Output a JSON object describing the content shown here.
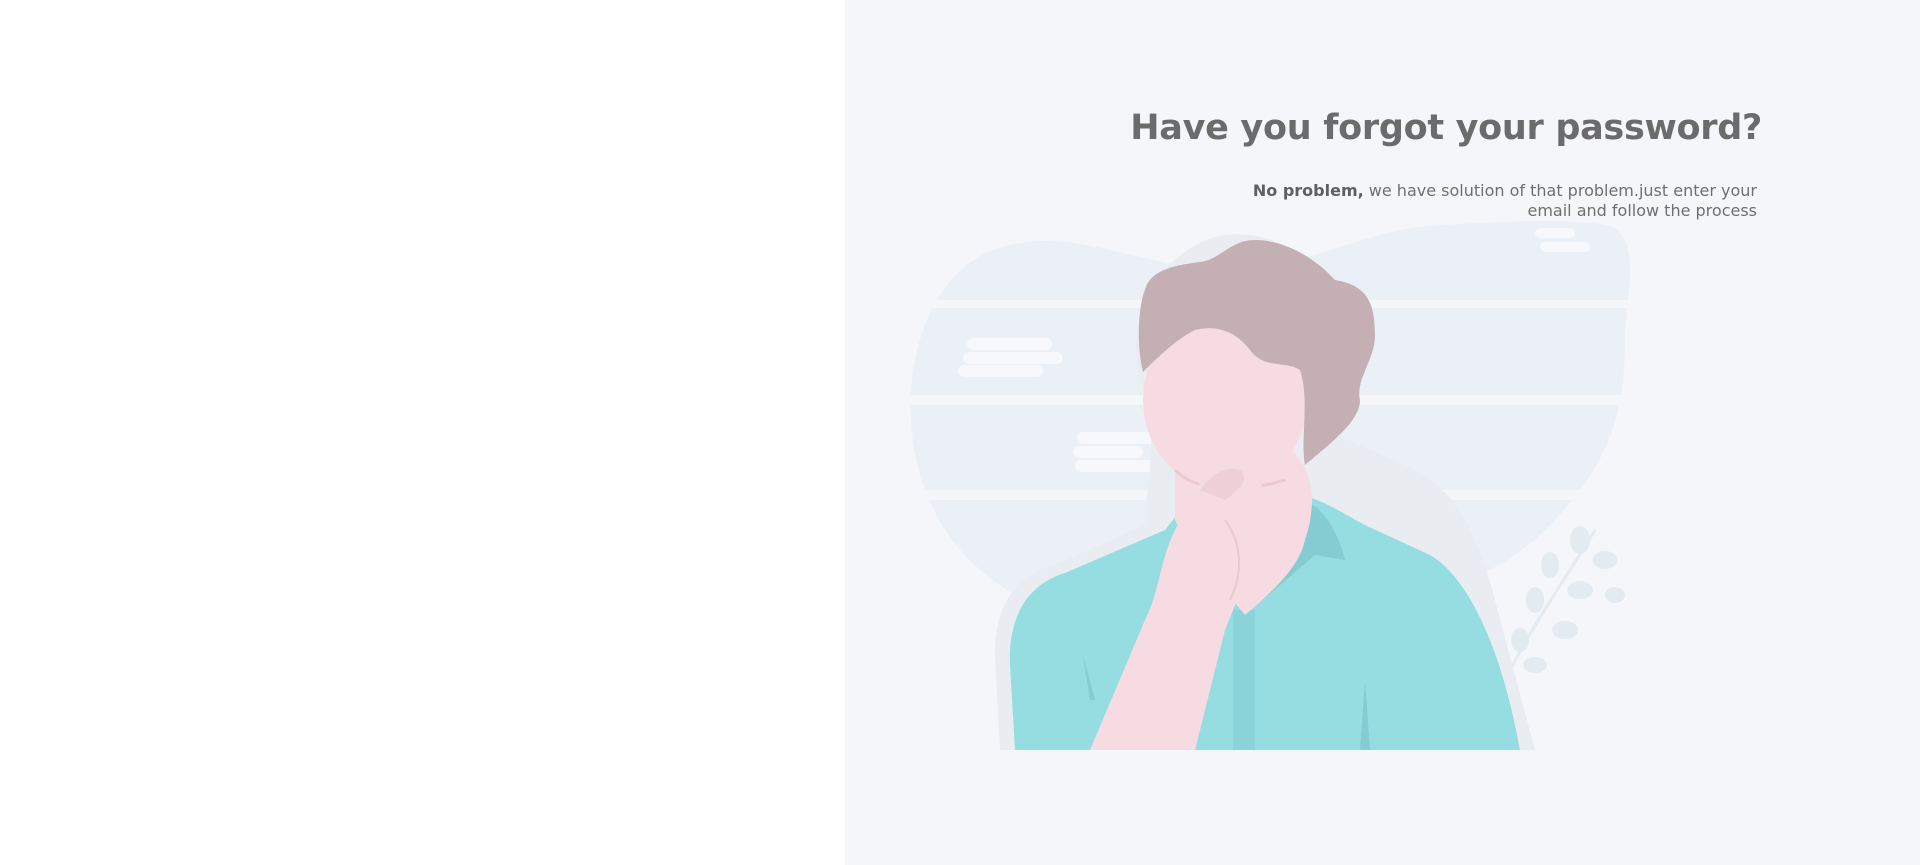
{
  "forgot_password": {
    "title": "Have you forgot your password?",
    "description_strong": "No problem,",
    "description_rest": " we have solution of that problem.just enter your email and follow the process"
  },
  "illustration": {
    "name": "thinking-person-illustration",
    "colors": {
      "panel_bg": "#f4f6fa",
      "backdrop": "#eaf0f6",
      "hair": "#c4afb4",
      "skin": "#f6dbe2",
      "shirt": "#96dde2",
      "shirt_shadow": "#84ccd2",
      "plant": "#e3ebf1"
    }
  }
}
